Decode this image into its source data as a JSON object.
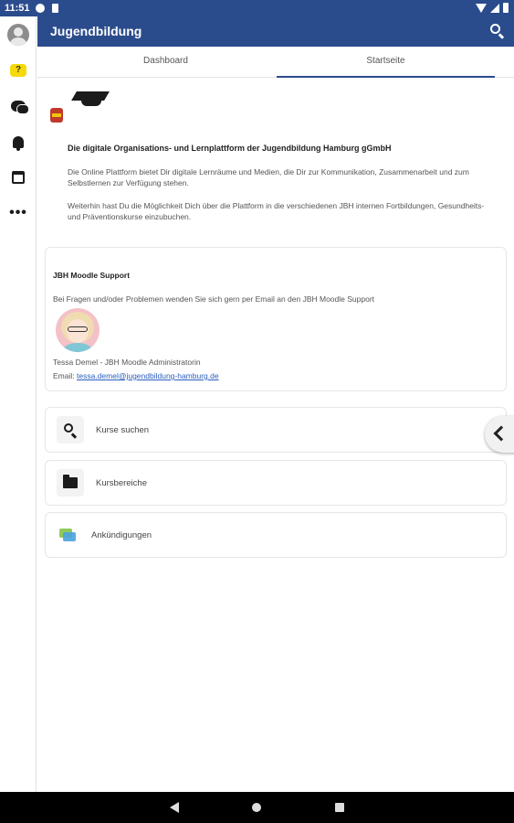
{
  "status_bar": {
    "time": "11:51"
  },
  "app_bar": {
    "title": "Jugendbildung"
  },
  "tabs": [
    {
      "label": "Dashboard",
      "active": false
    },
    {
      "label": "Startseite",
      "active": true
    }
  ],
  "rail": {
    "items": [
      "avatar",
      "site-home-icon",
      "messages-icon",
      "notifications-icon",
      "calendar-icon",
      "more-icon"
    ],
    "more_label": "•••"
  },
  "intro": {
    "title": "Die digitale Organisations- und Lernplattform der Jugendbildung Hamburg gGmbH",
    "paragraph1": "Die Online Plattform bietet Dir digitale Lernräume und Medien, die Dir zur Kommunikation, Zusammenarbeit und zum Selbstlernen zur Verfügung stehen.",
    "paragraph2": "Weiterhin hast Du die Möglichkeit Dich über die Plattform in die verschiedenen JBH internen Fortbildungen, Gesundheits- und Präventionskurse einzubuchen."
  },
  "support": {
    "title": "JBH Moodle Support",
    "text": "Bei Fragen und/oder Problemen wenden Sie sich gern per Email an den JBH Moodle Support",
    "admin_name": "Tessa Demel - JBH Moodle Administratorin",
    "email_label": "Email:",
    "email": "tessa.demel@jugendbildung-hamburg.de"
  },
  "blocks": [
    {
      "label": "Kurse suchen",
      "icon": "search-icon"
    },
    {
      "label": "Kursbereiche",
      "icon": "folder-icon"
    },
    {
      "label": "Ankündigungen",
      "icon": "announcements-icon"
    }
  ],
  "colors": {
    "primary": "#2b4c8c",
    "accent_yellow": "#f5d90a",
    "link": "#2b5fbd"
  }
}
